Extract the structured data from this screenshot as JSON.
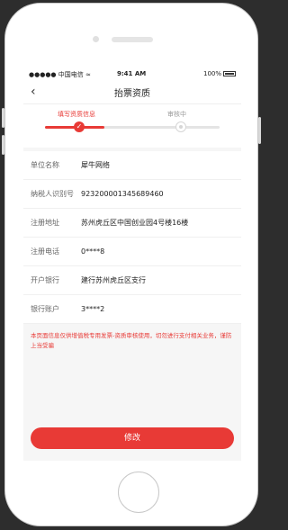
{
  "status_bar": {
    "carrier": "●●●●● 中国电信 ≈",
    "time": "9:41 AM",
    "battery": "100%"
  },
  "nav": {
    "back_icon": "chevron-left-icon",
    "title": "抬票资质"
  },
  "steps": {
    "active_label": "填写资质信息",
    "pending_label": "审核中"
  },
  "fields": [
    {
      "label": "单位名称",
      "value": "犀牛网络"
    },
    {
      "label": "纳税人识别号",
      "value": "923200001345689460"
    },
    {
      "label": "注册地址",
      "value": "苏州虎丘区中国创业园4号楼16楼"
    },
    {
      "label": "注册电话",
      "value": "0****8"
    },
    {
      "label": "开户银行",
      "value": "建行苏州虎丘区支行"
    },
    {
      "label": "银行账户",
      "value": "3****2"
    }
  ],
  "notice": "本页面信息仅供增值税专用发票-资质审核使用，切勿进行支付相关业务，谨防上当受骗",
  "action": {
    "modify_label": "修改"
  },
  "colors": {
    "accent": "#e83a36"
  }
}
